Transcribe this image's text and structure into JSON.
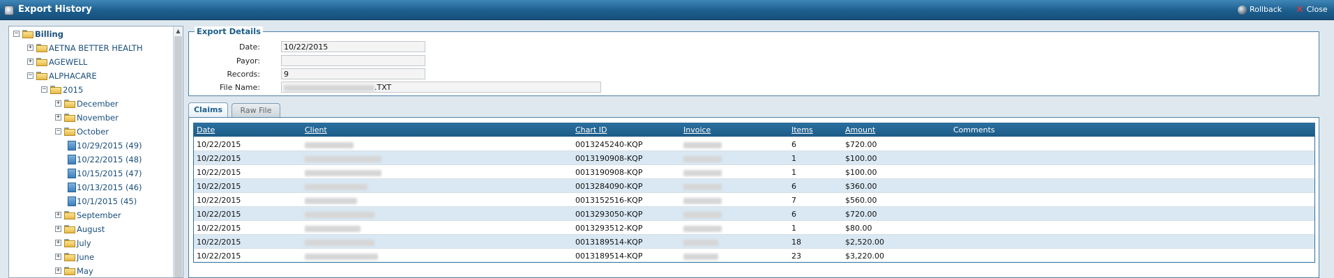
{
  "window": {
    "title": "Export History",
    "rollback_label": "Rollback",
    "close_label": "Close"
  },
  "tree": {
    "nodes": [
      {
        "label": "Billing",
        "toggle": "−",
        "type": "folder",
        "level": 0
      },
      {
        "label": "AETNA BETTER HEALTH",
        "toggle": "+",
        "type": "folder",
        "level": 1
      },
      {
        "label": "AGEWELL",
        "toggle": "+",
        "type": "folder",
        "level": 1
      },
      {
        "label": "ALPHACARE",
        "toggle": "−",
        "type": "folder",
        "level": 1
      },
      {
        "label": "2015",
        "toggle": "−",
        "type": "folder",
        "level": 2
      },
      {
        "label": "December",
        "toggle": "+",
        "type": "folder",
        "level": 3
      },
      {
        "label": "November",
        "toggle": "+",
        "type": "folder",
        "level": 3
      },
      {
        "label": "October",
        "toggle": "−",
        "type": "folder",
        "level": 3
      },
      {
        "label": "10/29/2015 (49)",
        "toggle": "",
        "type": "file",
        "level": 4
      },
      {
        "label": "10/22/2015 (48)",
        "toggle": "",
        "type": "file",
        "level": 4
      },
      {
        "label": "10/15/2015 (47)",
        "toggle": "",
        "type": "file",
        "level": 4
      },
      {
        "label": "10/13/2015 (46)",
        "toggle": "",
        "type": "file",
        "level": 4
      },
      {
        "label": "10/1/2015 (45)",
        "toggle": "",
        "type": "file",
        "level": 4
      },
      {
        "label": "September",
        "toggle": "+",
        "type": "folder",
        "level": 3
      },
      {
        "label": "August",
        "toggle": "+",
        "type": "folder",
        "level": 3
      },
      {
        "label": "July",
        "toggle": "+",
        "type": "folder",
        "level": 3
      },
      {
        "label": "June",
        "toggle": "+",
        "type": "folder",
        "level": 3
      },
      {
        "label": "May",
        "toggle": "+",
        "type": "folder",
        "level": 3
      }
    ]
  },
  "details": {
    "legend": "Export Details",
    "date_label": "Date:",
    "date_value": "10/22/2015",
    "payor_label": "Payor:",
    "payor_value": "",
    "records_label": "Records:",
    "records_value": "9",
    "filename_label": "File Name:",
    "filename_suffix": ".TXT"
  },
  "tabs": {
    "claims": "Claims",
    "raw_file": "Raw File"
  },
  "table": {
    "columns": [
      "Date",
      "Client",
      "Chart ID",
      "Invoice",
      "Items",
      "Amount",
      "Comments"
    ],
    "rows": [
      {
        "date": "10/22/2015",
        "chart_id": "0013245240-KQP",
        "items": "6",
        "amount": "$720.00"
      },
      {
        "date": "10/22/2015",
        "chart_id": "0013190908-KQP",
        "items": "1",
        "amount": "$100.00"
      },
      {
        "date": "10/22/2015",
        "chart_id": "0013190908-KQP",
        "items": "1",
        "amount": "$100.00"
      },
      {
        "date": "10/22/2015",
        "chart_id": "0013284090-KQP",
        "items": "6",
        "amount": "$360.00"
      },
      {
        "date": "10/22/2015",
        "chart_id": "0013152516-KQP",
        "items": "7",
        "amount": "$560.00"
      },
      {
        "date": "10/22/2015",
        "chart_id": "0013293050-KQP",
        "items": "6",
        "amount": "$720.00"
      },
      {
        "date": "10/22/2015",
        "chart_id": "0013293512-KQP",
        "items": "1",
        "amount": "$80.00"
      },
      {
        "date": "10/22/2015",
        "chart_id": "0013189514-KQP",
        "items": "18",
        "amount": "$2,520.00"
      },
      {
        "date": "10/22/2015",
        "chart_id": "0013189514-KQP",
        "items": "23",
        "amount": "$3,220.00"
      }
    ]
  }
}
